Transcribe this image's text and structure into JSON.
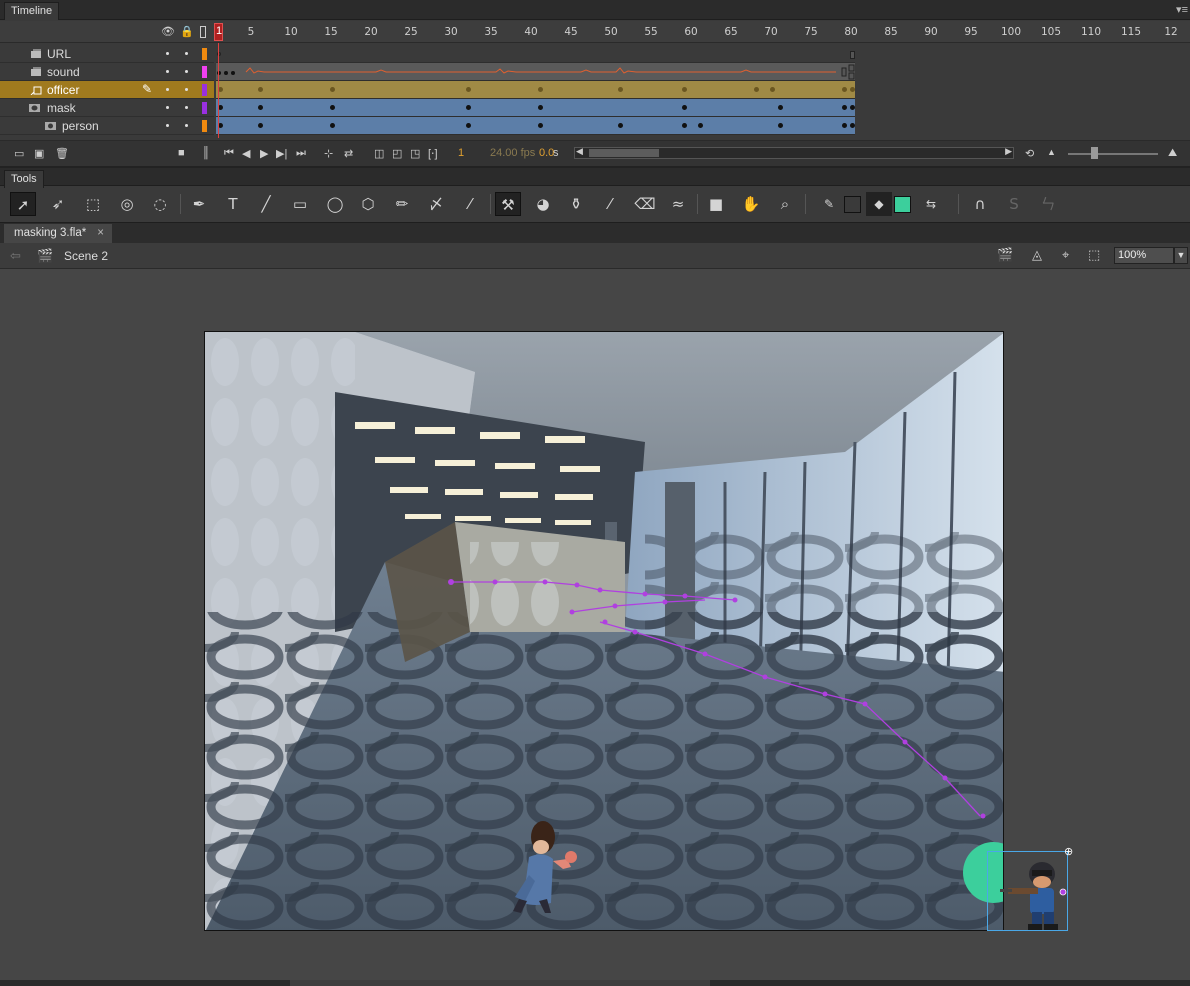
{
  "timeline": {
    "title": "Timeline",
    "ruler": [
      "1",
      "5",
      "10",
      "15",
      "20",
      "25",
      "30",
      "35",
      "40",
      "45",
      "50",
      "55",
      "60",
      "65",
      "70",
      "75",
      "80",
      "85",
      "90",
      "95",
      "100",
      "105",
      "110",
      "115",
      "12"
    ],
    "layers": [
      {
        "name": "URL",
        "color": "#f08a10"
      },
      {
        "name": "sound",
        "color": "#f040f0"
      },
      {
        "name": "officer",
        "color": "#9a30e0"
      },
      {
        "name": "mask",
        "color": "#9a30e0"
      },
      {
        "name": "person",
        "color": "#f08a10"
      }
    ],
    "current_frame": "1",
    "fps": "24.00 fps",
    "time": "0.0",
    "time_unit": "s"
  },
  "tools": {
    "title": "Tools",
    "colors": {
      "stroke": "#3a3a3a",
      "fill": "#3ccf9c"
    }
  },
  "document": {
    "tab": "masking 3.fla*",
    "scene": "Scene 2",
    "zoom": "100%"
  }
}
